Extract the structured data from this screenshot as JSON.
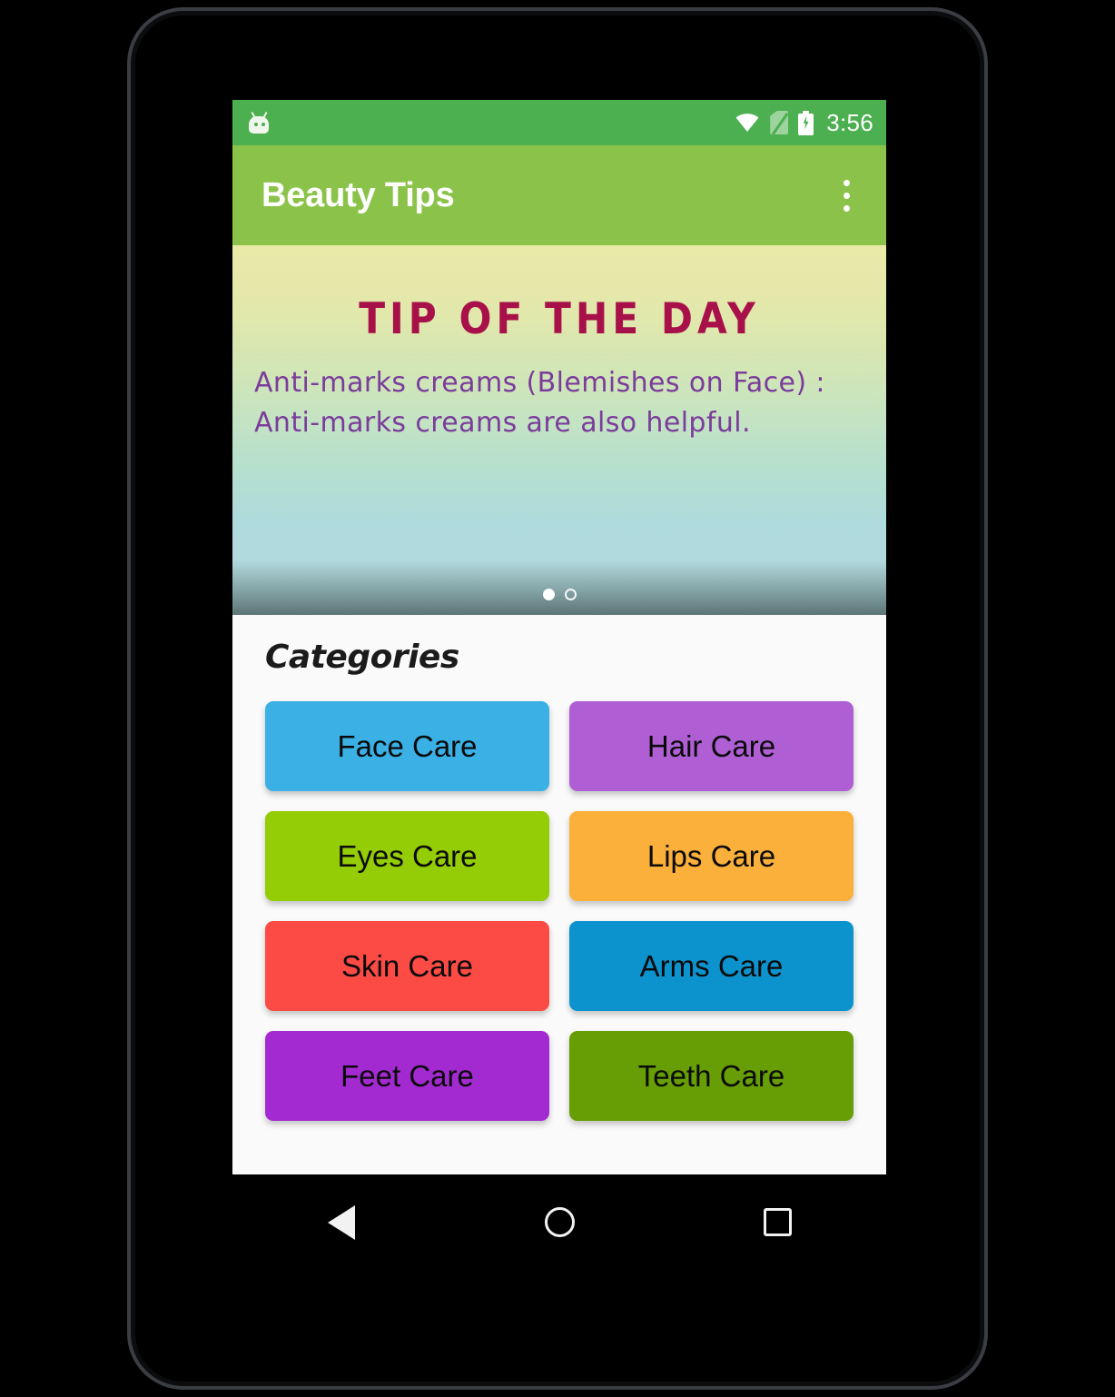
{
  "status_bar": {
    "icons": [
      "android-head-icon",
      "wifi-icon",
      "no-sim-icon",
      "battery-charging-icon"
    ],
    "clock": "3:56",
    "background": "#4CAF50"
  },
  "app_bar": {
    "title": "Beauty Tips",
    "overflow_icon": "more-vert-icon",
    "background": "#8BC34A"
  },
  "tip_banner": {
    "title": "Tip of the Day",
    "text": "Anti-marks creams (Blemishes on Face) : Anti-marks creams are also helpful.",
    "title_color": "#A8104A",
    "text_color": "#7B3C9B",
    "gradient_top": "#EAE9A8",
    "gradient_bottom": "#B4DBDD",
    "pager": {
      "total": 2,
      "active_index": 0
    }
  },
  "categories": {
    "heading": "Categories",
    "items": [
      {
        "label": "Face Care",
        "color": "#3BB0E5"
      },
      {
        "label": "Hair Care",
        "color": "#AF5FD3"
      },
      {
        "label": "Eyes Care",
        "color": "#94CC06"
      },
      {
        "label": "Lips Care",
        "color": "#FBB03B"
      },
      {
        "label": "Skin Care",
        "color": "#FC4B45"
      },
      {
        "label": "Arms Care",
        "color": "#0C93CE"
      },
      {
        "label": "Feet Care",
        "color": "#A32AD1"
      },
      {
        "label": "Teeth Care",
        "color": "#679D05"
      }
    ]
  },
  "nav_bar": {
    "back_label": "Back",
    "home_label": "Home",
    "recents_label": "Recents"
  }
}
